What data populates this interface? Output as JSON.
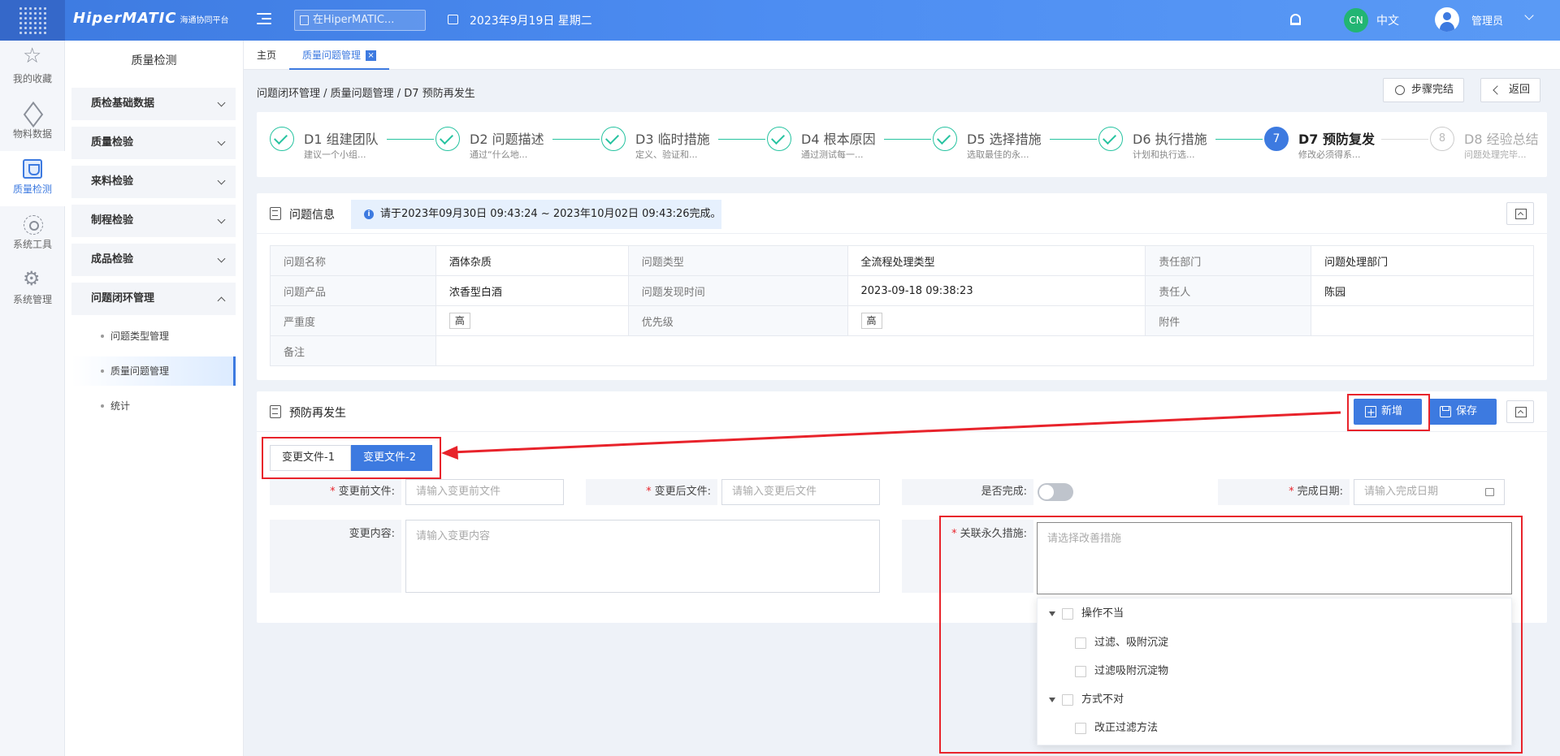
{
  "topbar": {
    "logo": "HiperMATIC",
    "logo_sub": "海通协同平台",
    "search_placeholder": "在HiperMATIC...",
    "date": "2023年9月19日 星期二",
    "lang_badge": "CN",
    "lang": "中文",
    "user": "管理员"
  },
  "rail": {
    "items": [
      {
        "label": "我的收藏",
        "icon": "star-icon"
      },
      {
        "label": "物料数据",
        "icon": "cube-icon"
      },
      {
        "label": "质量检测",
        "icon": "shield-icon"
      },
      {
        "label": "系统工具",
        "icon": "network-icon"
      },
      {
        "label": "系统管理",
        "icon": "gear-icon"
      }
    ]
  },
  "sidebar": {
    "title": "质量检测",
    "groups": [
      {
        "label": "质检基础数据"
      },
      {
        "label": "质量检验"
      },
      {
        "label": "来料检验"
      },
      {
        "label": "制程检验"
      },
      {
        "label": "成品检验"
      },
      {
        "label": "问题闭环管理"
      }
    ],
    "subitems": [
      {
        "label": "问题类型管理"
      },
      {
        "label": "质量问题管理"
      },
      {
        "label": "统计"
      }
    ]
  },
  "tabs": [
    {
      "label": "主页"
    },
    {
      "label": "质量问题管理",
      "close": "×"
    }
  ],
  "breadcrumb": "问题闭环管理 / 质量问题管理 / D7 预防再发生",
  "header_buttons": {
    "steps_done": "步骤完结",
    "back": "返回"
  },
  "steps": [
    {
      "title": "D1 组建团队",
      "desc": "建议一个小组...",
      "state": "done"
    },
    {
      "title": "D2 问题描述",
      "desc": "通过“什么地...",
      "state": "done"
    },
    {
      "title": "D3 临时措施",
      "desc": "定义、验证和...",
      "state": "done"
    },
    {
      "title": "D4 根本原因",
      "desc": "通过测试每一...",
      "state": "done"
    },
    {
      "title": "D5 选择措施",
      "desc": "选取最佳的永...",
      "state": "done"
    },
    {
      "title": "D6 执行措施",
      "desc": "计划和执行选...",
      "state": "done"
    },
    {
      "title": "D7 预防复发",
      "desc": "修改必须得系...",
      "state": "current",
      "num": "7"
    },
    {
      "title": "D8 经验总结",
      "desc": "问题处理完毕...",
      "state": "wait",
      "num": "8"
    }
  ],
  "problem_info": {
    "title": "问题信息",
    "banner": "请于2023年09月30日 09:43:24 ~ 2023年10月02日 09:43:26完成。",
    "rows": [
      {
        "l1": "问题名称",
        "v1": "酒体杂质",
        "l2": "问题类型",
        "v2": "全流程处理类型",
        "l3": "责任部门",
        "v3": "问题处理部门"
      },
      {
        "l1": "问题产品",
        "v1": "浓香型白酒",
        "l2": "问题发现时间",
        "v2": "2023-09-18 09:38:23",
        "l3": "责任人",
        "v3": "陈园"
      },
      {
        "l1": "严重度",
        "v1": "高",
        "l2": "优先级",
        "v2": "高",
        "l3": "附件",
        "v3": ""
      },
      {
        "l1": "备注",
        "v1": ""
      }
    ]
  },
  "prevent": {
    "title": "预防再发生",
    "add_label": "新增",
    "save_label": "保存",
    "file_tabs": [
      "变更文件-1",
      "变更文件-2"
    ],
    "fields": {
      "before_label": "变更前文件:",
      "before_placeholder": "请输入变更前文件",
      "after_label": "变更后文件:",
      "after_placeholder": "请输入变更后文件",
      "done_label": "是否完成:",
      "date_label": "完成日期:",
      "date_placeholder": "请输入完成日期",
      "content_label": "变更内容:",
      "content_placeholder": "请输入变更内容",
      "measure_label": "关联永久措施:",
      "measure_placeholder": "请选择改善措施"
    },
    "tree": [
      {
        "label": "操作不当",
        "level": 0
      },
      {
        "label": "过滤、吸附沉淀",
        "level": 1
      },
      {
        "label": "过滤吸附沉淀物",
        "level": 1
      },
      {
        "label": "方式不对",
        "level": 0
      },
      {
        "label": "改正过滤方法",
        "level": 1
      }
    ]
  },
  "colors": {
    "accent": "#3d7ae0",
    "done": "#26c3a0",
    "highlight": "#e8232b"
  }
}
